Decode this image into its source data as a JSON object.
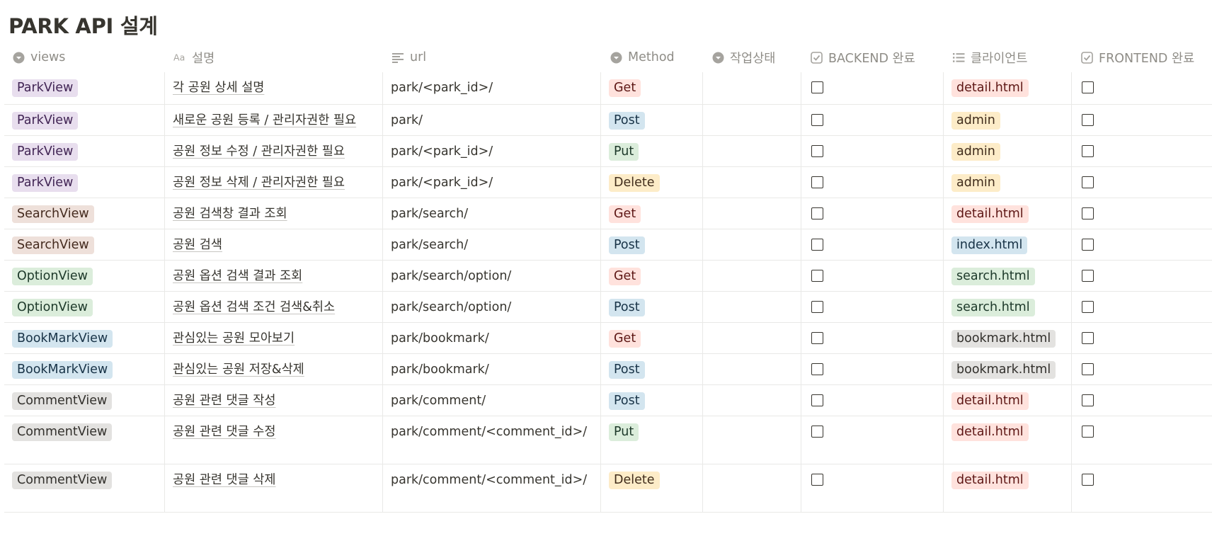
{
  "database": {
    "title": "PARK API 설계"
  },
  "columns": {
    "views": {
      "label": "views",
      "icon": "select-icon"
    },
    "description": {
      "label": "설명",
      "icon": "title-aa-icon"
    },
    "url": {
      "label": "url",
      "icon": "text-lines-icon"
    },
    "method": {
      "label": "Method",
      "icon": "select-icon"
    },
    "status": {
      "label": "작업상태",
      "icon": "select-icon"
    },
    "backend": {
      "label": "BACKEND 완료",
      "icon": "checkbox-icon"
    },
    "client": {
      "label": "클라이언트",
      "icon": "multi-select-list-icon"
    },
    "frontend": {
      "label": "FRONTEND 완료",
      "icon": "checkbox-icon"
    }
  },
  "colors": {
    "purple_bg": "#e8deee",
    "purple_fg": "#412454",
    "brown_bg": "#eee0da",
    "brown_fg": "#442a1e",
    "green_bg": "#dbeddb",
    "green_fg": "#1c3829",
    "blue_bg": "#d3e5ef",
    "blue_fg": "#183347",
    "gray_bg": "#e3e2e0",
    "gray_fg": "#32302c",
    "red_bg": "#ffe2dd",
    "red_fg": "#5d1715",
    "yellow_bg": "#fdecc8",
    "yellow_fg": "#402c1b",
    "header_text": "#8f8d87",
    "border": "#e9e9e7"
  },
  "rows": [
    {
      "view": "ParkView",
      "view_color": "purple",
      "description": "각 공원 상세 설명",
      "url": "park/<park_id>/",
      "method": "Get",
      "method_color": "red",
      "status": "",
      "backend_done": false,
      "client": "detail.html",
      "client_color": "red",
      "frontend_done": false
    },
    {
      "view": "ParkView",
      "view_color": "purple",
      "description": "새로운 공원 등록 / 관리자권한 필요",
      "url": "park/",
      "method": "Post",
      "method_color": "blue",
      "status": "",
      "backend_done": false,
      "client": "admin",
      "client_color": "yellow",
      "frontend_done": false
    },
    {
      "view": "ParkView",
      "view_color": "purple",
      "description": "공원 정보 수정 / 관리자권한 필요",
      "url": "park/<park_id>/",
      "method": "Put",
      "method_color": "green",
      "status": "",
      "backend_done": false,
      "client": "admin",
      "client_color": "yellow",
      "frontend_done": false
    },
    {
      "view": "ParkView",
      "view_color": "purple",
      "description": "공원 정보 삭제 / 관리자권한 필요",
      "url": "park/<park_id>/",
      "method": "Delete",
      "method_color": "yellow",
      "status": "",
      "backend_done": false,
      "client": "admin",
      "client_color": "yellow",
      "frontend_done": false
    },
    {
      "view": "SearchView",
      "view_color": "brown",
      "description": "공원 검색창 결과 조회",
      "url": "park/search/",
      "method": "Get",
      "method_color": "red",
      "status": "",
      "backend_done": false,
      "client": "detail.html",
      "client_color": "red",
      "frontend_done": false
    },
    {
      "view": "SearchView",
      "view_color": "brown",
      "description": "공원 검색",
      "url": "park/search/",
      "method": "Post",
      "method_color": "blue",
      "status": "",
      "backend_done": false,
      "client": "index.html",
      "client_color": "blue",
      "frontend_done": false
    },
    {
      "view": "OptionView",
      "view_color": "green",
      "description": "공원 옵션 검색 결과 조회",
      "url": "park/search/option/",
      "method": "Get",
      "method_color": "red",
      "status": "",
      "backend_done": false,
      "client": "search.html",
      "client_color": "green",
      "frontend_done": false
    },
    {
      "view": "OptionView",
      "view_color": "green",
      "description": "공원 옵션 검색 조건 검색&취소",
      "url": "park/search/option/",
      "method": "Post",
      "method_color": "blue",
      "status": "",
      "backend_done": false,
      "client": "search.html",
      "client_color": "green",
      "frontend_done": false
    },
    {
      "view": "BookMarkView",
      "view_color": "blue",
      "description": "관심있는 공원 모아보기",
      "url": "park/bookmark/",
      "method": "Get",
      "method_color": "red",
      "status": "",
      "backend_done": false,
      "client": "bookmark.html",
      "client_color": "gray",
      "frontend_done": false
    },
    {
      "view": "BookMarkView",
      "view_color": "blue",
      "description": "관심있는 공원 저장&삭제",
      "url": "park/bookmark/",
      "method": "Post",
      "method_color": "blue",
      "status": "",
      "backend_done": false,
      "client": "bookmark.html",
      "client_color": "gray",
      "frontend_done": false
    },
    {
      "view": "CommentView",
      "view_color": "gray",
      "description": "공원 관련 댓글 작성",
      "url": "park/comment/",
      "method": "Post",
      "method_color": "blue",
      "status": "",
      "backend_done": false,
      "client": "detail.html",
      "client_color": "red",
      "frontend_done": false
    },
    {
      "view": "CommentView",
      "view_color": "gray",
      "description": "공원 관련 댓글 수정",
      "url": "park/comment/<comment_id>/",
      "method": "Put",
      "method_color": "green",
      "status": "",
      "backend_done": false,
      "client": "detail.html",
      "client_color": "red",
      "frontend_done": false
    },
    {
      "view": "CommentView",
      "view_color": "gray",
      "description": "공원 관련 댓글 삭제",
      "url": "park/comment/<comment_id>/",
      "method": "Delete",
      "method_color": "yellow",
      "status": "",
      "backend_done": false,
      "client": "detail.html",
      "client_color": "red",
      "frontend_done": false
    }
  ]
}
